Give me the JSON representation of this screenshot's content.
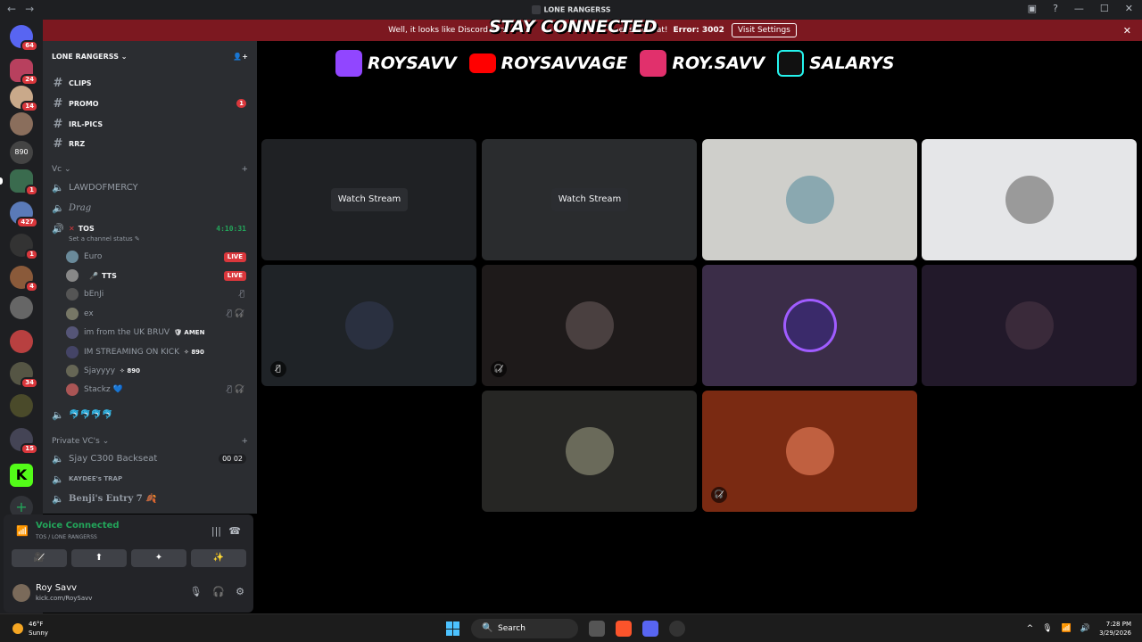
{
  "window": {
    "title": "LONE RANGERSS",
    "nav_back": "←",
    "nav_fwd": "→",
    "controls": [
      "▣",
      "?",
      "—",
      "☐",
      "✕"
    ]
  },
  "banner": {
    "message": "Well, it looks like Discord is not ... — let's fix that!",
    "message_left": "Well, it looks like Discord is n",
    "message_right": "et's fix that!",
    "error": "Error: 3002",
    "button": "Visit Settings",
    "close": "✕"
  },
  "overlay_title": "STAY CONNECTED",
  "socials": [
    {
      "name": "ROYSAVV",
      "icon": "twitch-icon",
      "color": "#9146ff"
    },
    {
      "name": "ROYSAVVAGE",
      "icon": "youtube-icon",
      "color": "#ff0000"
    },
    {
      "name": "ROY.SAVV",
      "icon": "instagram-icon",
      "color": "#e1306c"
    },
    {
      "name": "SALARYS",
      "icon": "tiktok-icon",
      "color": "#25f4ee"
    }
  ],
  "guilds": [
    {
      "badge": "64",
      "color": "#5865f2"
    },
    {
      "badge": "24",
      "color": "#b8405e"
    },
    {
      "badge": "14",
      "color": "#c9a98a"
    },
    {
      "badge": "",
      "color": "#8a6e5c"
    },
    {
      "badge": "",
      "color": "#444",
      "label": "890"
    },
    {
      "badge": "1",
      "color": "#3a6b4e"
    },
    {
      "badge": "427",
      "color": "#5a7ab8"
    },
    {
      "badge": "1",
      "color": "#333"
    },
    {
      "badge": "4",
      "color": "#8a5a3a"
    },
    {
      "badge": "",
      "color": "#666"
    },
    {
      "badge": "",
      "color": "#b84040"
    },
    {
      "badge": "34",
      "color": "#554"
    },
    {
      "badge": "",
      "color": "#4a4a2a"
    },
    {
      "badge": "15",
      "color": "#445"
    },
    {
      "badge": "",
      "color": "#53fc18"
    }
  ],
  "server": {
    "name": "LONE RANGERSS",
    "chevron": "⌄",
    "add_icon": "👤+"
  },
  "text_channels": [
    {
      "name": "CLIPS",
      "badge": ""
    },
    {
      "name": "PROMO",
      "badge": "1"
    },
    {
      "name": "IRL-PICS",
      "badge": ""
    },
    {
      "name": "RRZ",
      "badge": ""
    }
  ],
  "vc_category": "Vc",
  "voice_channels_a": [
    {
      "name": "LAWDOFMERCY"
    },
    {
      "name": "Drag"
    }
  ],
  "active_vc": {
    "name": "TOS",
    "timer": "4:10:31",
    "status": "Set a channel status"
  },
  "voice_users": [
    {
      "name": "Euro",
      "live": "LIVE",
      "tag": "",
      "color": "#6a8a9a",
      "icon": ""
    },
    {
      "name": "TTS",
      "live": "LIVE",
      "tag": "",
      "color": "#888",
      "icon": ""
    },
    {
      "name": "bEnJi",
      "live": "",
      "tag": "",
      "color": "#555",
      "icon": "🎙̸"
    },
    {
      "name": "ex",
      "live": "",
      "tag": "",
      "color": "#776",
      "icon": "🎙̸ 🎧̸"
    },
    {
      "name": "im from the UK BRUV",
      "live": "",
      "tag": "AMEN",
      "color": "#557",
      "icon": ""
    },
    {
      "name": "IM STREAMING ON KICK",
      "live": "",
      "tag": "890",
      "color": "#446",
      "icon": ""
    },
    {
      "name": "Sjayyyy",
      "live": "",
      "tag": "890",
      "color": "#665",
      "icon": ""
    },
    {
      "name": "Stackz 💙",
      "live": "",
      "tag": "",
      "color": "#a55",
      "icon": "🎙̸ 🎧̸"
    }
  ],
  "emoji_channel": "🐬🐬🐬🐬",
  "private_category": "Private VC's",
  "private_channels": [
    {
      "name": "Sjay C300 Backseat",
      "counts": "00  02"
    },
    {
      "name": "KAYDEE's TRAP",
      "counts": ""
    },
    {
      "name": "Benji's Entry 7 🍂",
      "counts": ""
    }
  ],
  "voice_panel": {
    "status": "Voice Connected",
    "location": "TOS / LONE RANGERSS",
    "buttons": [
      "🎥̸",
      "⬆",
      "✦",
      "✨"
    ]
  },
  "user": {
    "name": "Roy Savv",
    "status": "kick.com/RoySavv",
    "controls": [
      "🎙",
      "🎧",
      "⚙"
    ]
  },
  "tiles": [
    {
      "bg": "#1f2124",
      "watch": "Watch Stream",
      "avatar": ""
    },
    {
      "bg": "#2a2c2e",
      "watch": "Watch Stream",
      "avatar": ""
    },
    {
      "bg": "#cfcfcb",
      "watch": "",
      "avatar": "#8aa8b0"
    },
    {
      "bg": "#e5e6e8",
      "watch": "",
      "avatar": "#9a9a9a"
    },
    {
      "bg": "#1f2327",
      "watch": "",
      "avatar": "#2a3040",
      "mute": "🎙̸"
    },
    {
      "bg": "#1e1a1a",
      "watch": "",
      "avatar": "#4a4040",
      "mute": "🎧̸"
    },
    {
      "bg": "#3b2d48",
      "watch": "",
      "avatar": "#3a2a6a"
    },
    {
      "bg": "#22192a",
      "watch": "",
      "avatar": "#3a2a3a"
    },
    {
      "bg": "#262624",
      "watch": "",
      "avatar": "#6a6a5a"
    },
    {
      "bg": "#7a2a12",
      "watch": "",
      "avatar": "#c06040",
      "mute": "🎧̸"
    }
  ],
  "taskbar": {
    "temp": "46°F",
    "weather": "Sunny",
    "search": "Search",
    "time": "7:28 PM",
    "date": "3/29/2026",
    "tray": [
      "^",
      "🎙",
      "📶",
      "🔊"
    ]
  }
}
